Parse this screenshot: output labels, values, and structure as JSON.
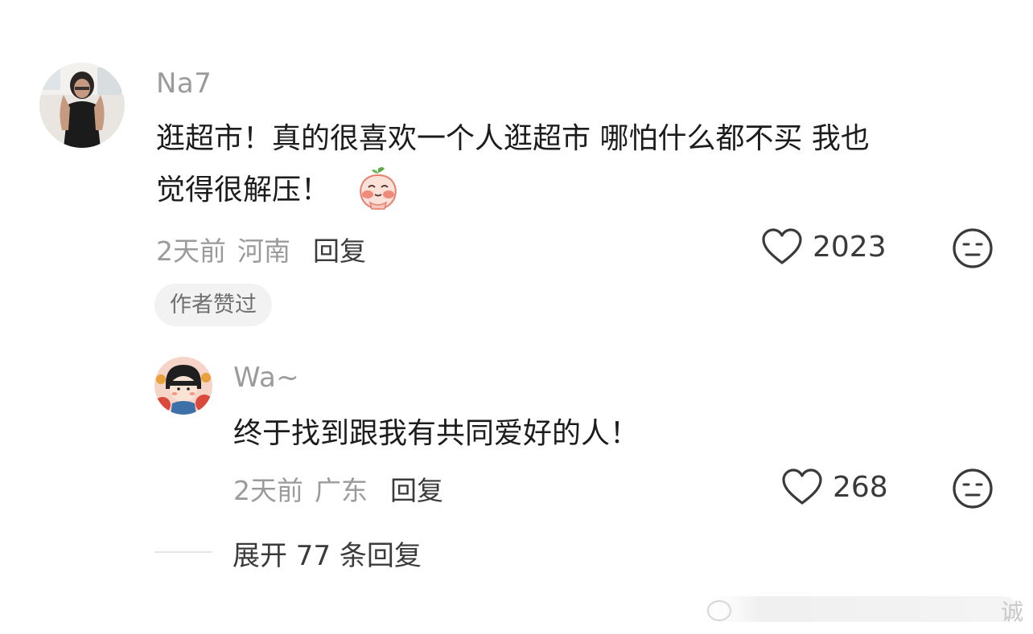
{
  "comments": [
    {
      "username": "Na7",
      "text_line1": "逛超市！真的很喜欢一个人逛超市 哪怕什么都不买 我也",
      "text_line2": "觉得很解压！",
      "time": "2天前",
      "region": "河南",
      "reply_label": "回复",
      "likes": "2023",
      "badge": "作者赞过"
    },
    {
      "username": "Wa~",
      "text": "终于找到跟我有共同爱好的人！",
      "time": "2天前",
      "region": "广东",
      "reply_label": "回复",
      "likes": "268"
    }
  ],
  "expand_replies": "展开 77 条回复",
  "watermark": "诚",
  "icons": {
    "like": "heart-outline-icon",
    "dislike": "meh-face-icon",
    "sticker": "peach-emoji-sticker"
  },
  "colors": {
    "username": "#9b9b9b",
    "text": "#1c1c1c",
    "meta": "#9b9b9b",
    "badge_bg": "#f2f2f2"
  }
}
